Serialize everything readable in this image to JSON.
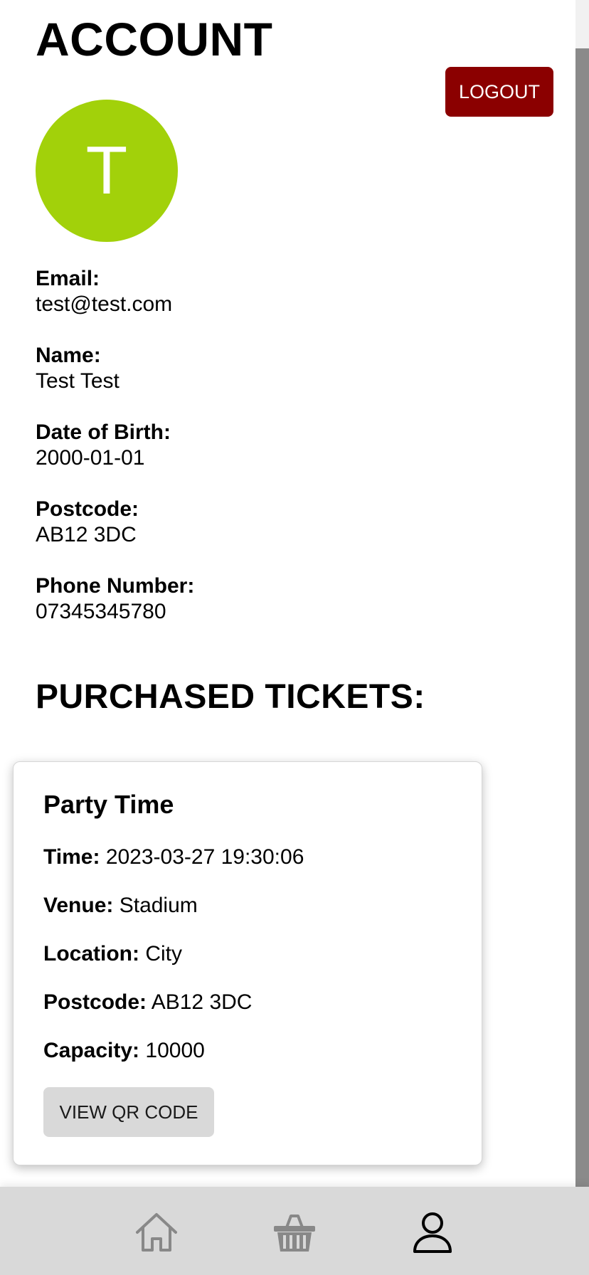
{
  "header": {
    "title": "ACCOUNT",
    "logout_label": "LOGOUT"
  },
  "profile": {
    "avatar_initial": "T",
    "avatar_color": "#a2d10a",
    "fields": [
      {
        "label": "Email:",
        "value": "test@test.com"
      },
      {
        "label": "Name:",
        "value": "Test Test"
      },
      {
        "label": "Date of Birth:",
        "value": "2000-01-01"
      },
      {
        "label": "Postcode:",
        "value": "AB12 3DC"
      },
      {
        "label": "Phone Number:",
        "value": "07345345780"
      }
    ]
  },
  "tickets": {
    "section_title": "PURCHASED TICKETS:",
    "items": [
      {
        "title": "Party Time",
        "rows": [
          {
            "label": "Time:",
            "value": "2023-03-27 19:30:06"
          },
          {
            "label": "Venue:",
            "value": "Stadium"
          },
          {
            "label": "Location:",
            "value": "City"
          },
          {
            "label": "Postcode:",
            "value": "AB12 3DC"
          },
          {
            "label": "Capacity:",
            "value": "10000"
          }
        ],
        "qr_button_label": "VIEW QR CODE"
      }
    ]
  },
  "bottom_nav": {
    "items": [
      {
        "icon": "home-icon",
        "active": false
      },
      {
        "icon": "basket-icon",
        "active": false
      },
      {
        "icon": "user-icon",
        "active": true
      }
    ]
  },
  "colors": {
    "logout_bg": "#8b0000",
    "nav_bg": "#d9d9d9",
    "nav_inactive": "#888888",
    "nav_active": "#000000"
  }
}
